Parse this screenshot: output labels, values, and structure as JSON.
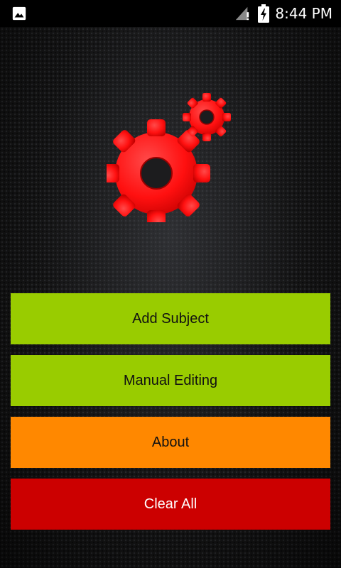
{
  "status_bar": {
    "time": "8:44 PM",
    "icons": [
      "gallery-icon",
      "signal-icon",
      "battery-charging-icon"
    ]
  },
  "logo": {
    "icon": "gears-icon",
    "color": "#ff1a1a"
  },
  "menu": {
    "add_subject": "Add Subject",
    "manual_editing": "Manual Editing",
    "about": "About",
    "clear_all": "Clear All"
  },
  "colors": {
    "green": "#99cc00",
    "orange": "#ff8800",
    "red": "#cc0000"
  }
}
